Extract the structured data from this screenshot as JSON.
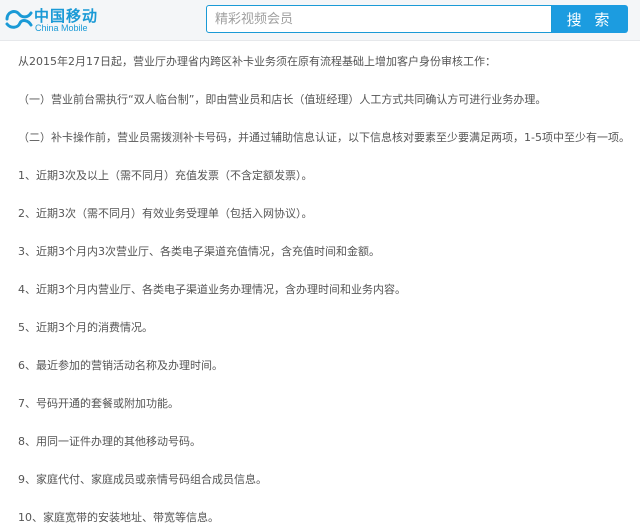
{
  "header": {
    "logo": {
      "cn": "中国移动",
      "en": "China Mobile",
      "icon": "china-mobile-logo-icon"
    },
    "search": {
      "placeholder": "精彩视频会员",
      "button_label": "搜 索"
    }
  },
  "colors": {
    "brand_blue": "#1a9ad6",
    "button_blue": "#1c9ce0",
    "text": "#555555",
    "header_bg": "#f4f6f8"
  },
  "article": {
    "paragraphs": [
      "从2015年2月17日起，营业厅办理省内跨区补卡业务须在原有流程基础上增加客户身份审核工作：",
      "（一）营业前台需执行“双人临台制”，即由营业员和店长（值班经理）人工方式共同确认方可进行业务办理。",
      "（二）补卡操作前，营业员需拨测补卡号码，并通过辅助信息认证，以下信息核对要素至少要满足两项，1-5项中至少有一项。",
      "1、近期3次及以上（需不同月）充值发票（不含定额发票）。",
      "2、近期3次（需不同月）有效业务受理单（包括入网协议）。",
      "3、近期3个月内3次营业厅、各类电子渠道充值情况，含充值时间和金额。",
      "4、近期3个月内营业厅、各类电子渠道业务办理情况，含办理时间和业务内容。",
      "5、近期3个月的消费情况。",
      "6、最近参加的营销活动名称及办理时间。",
      "7、号码开通的套餐或附加功能。",
      "8、用同一证件办理的其他移动号码。",
      "9、家庭代付、家庭成员或亲情号码组合成员信息。",
      "10、家庭宽带的安装地址、带宽等信息。"
    ]
  }
}
